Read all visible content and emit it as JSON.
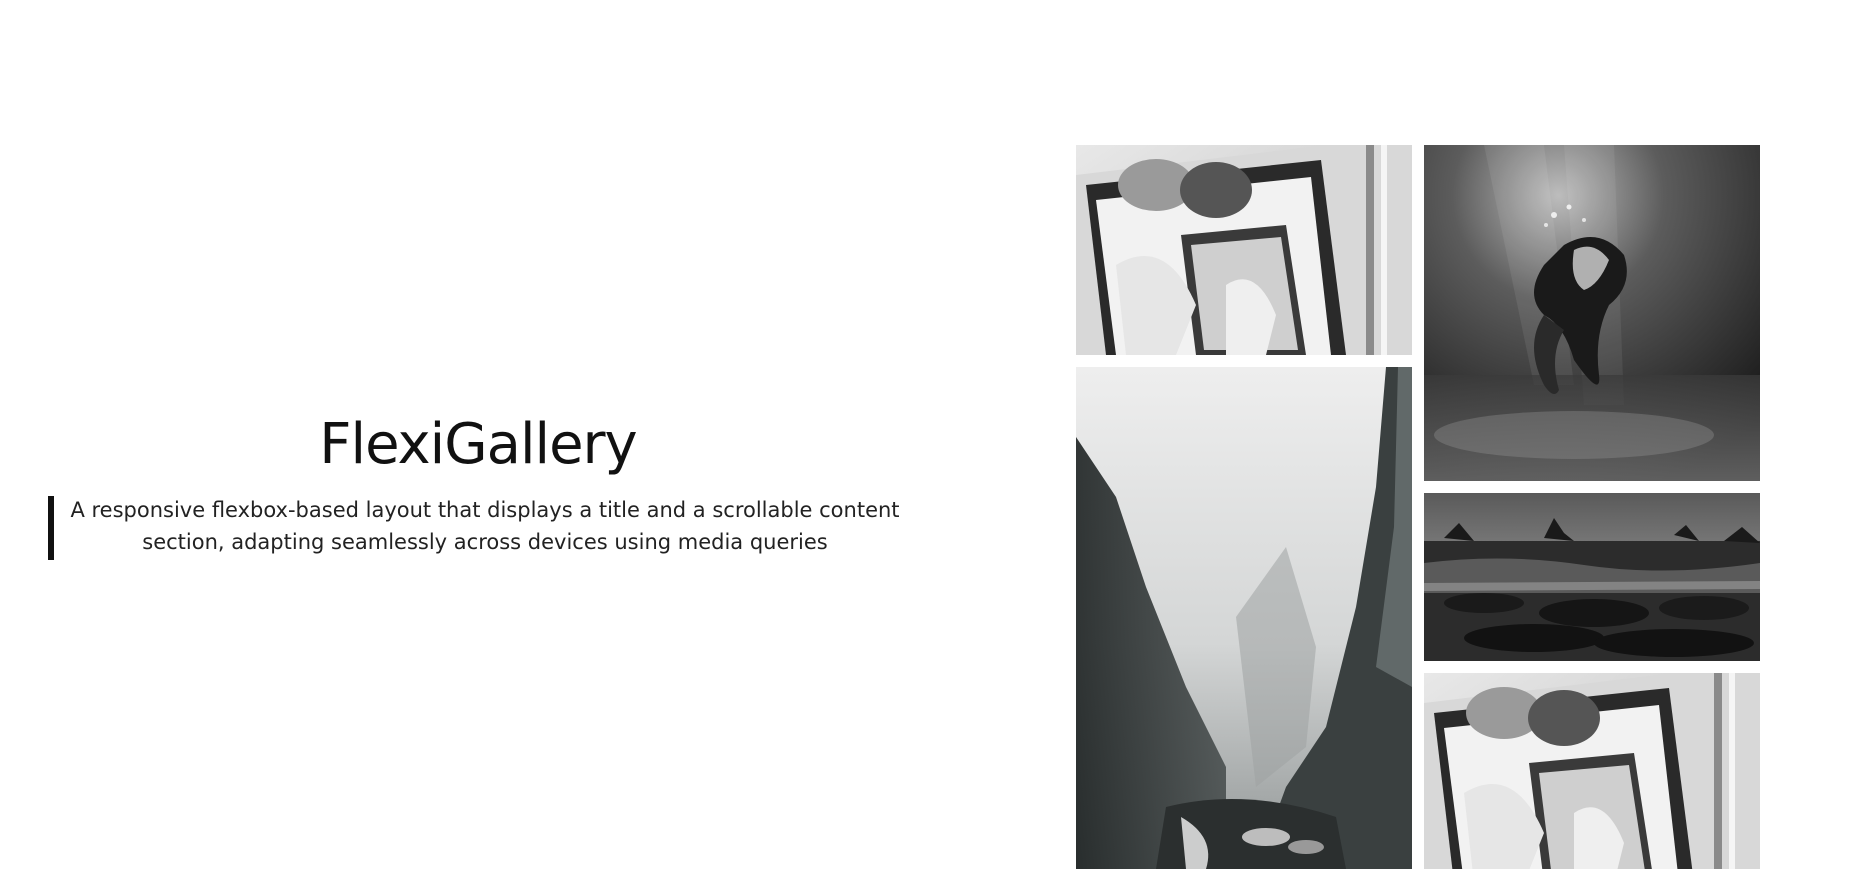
{
  "header": {
    "title": "FlexiGallery",
    "description": "A responsive flexbox-based layout that displays a title and a scrollable content section, adapting seamlessly across devices using media queries"
  },
  "gallery": {
    "items": [
      {
        "subject": "couple kissing in car window (black and white)"
      },
      {
        "subject": "misty mountain canyon (black and white)"
      },
      {
        "subject": "person floating underwater (black and white)"
      },
      {
        "subject": "rocky shoreline at dusk (black and white)"
      },
      {
        "subject": "couple kissing in car window (black and white)"
      }
    ]
  },
  "colors": {
    "background": "#ffffff",
    "text": "#111111",
    "accent_bar": "#111111"
  }
}
